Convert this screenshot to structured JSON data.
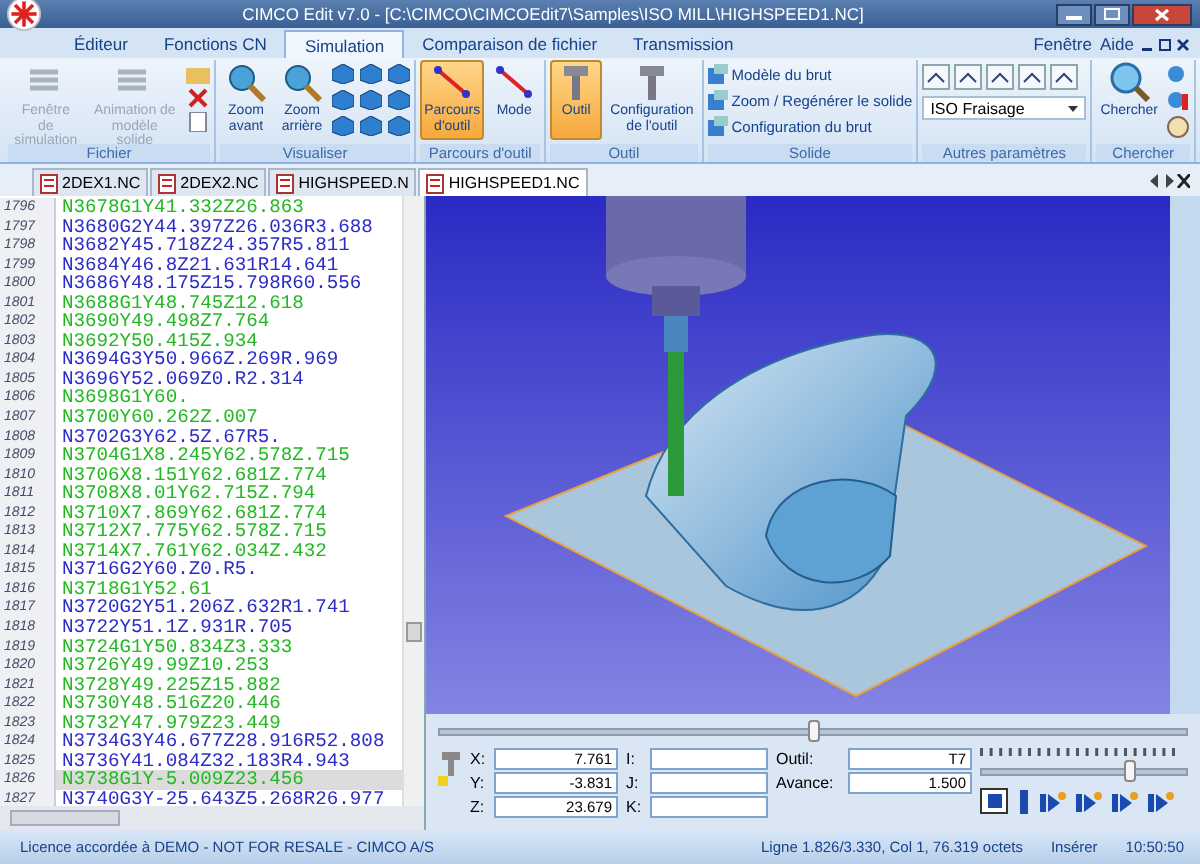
{
  "window": {
    "title": "CIMCO Edit v7.0 - [C:\\CIMCO\\CIMCOEdit7\\Samples\\ISO MILL\\HIGHSPEED1.NC]"
  },
  "menu_tabs": [
    {
      "label": "Éditeur",
      "selected": false
    },
    {
      "label": "Fonctions CN",
      "selected": false
    },
    {
      "label": "Simulation",
      "selected": true
    },
    {
      "label": "Comparaison de fichier",
      "selected": false
    },
    {
      "label": "Transmission",
      "selected": false
    }
  ],
  "menu_right": [
    {
      "label": "Fenêtre"
    },
    {
      "label": "Aide"
    }
  ],
  "ribbon_groups": [
    {
      "kind": "file",
      "label": "Fichier",
      "buttons": [
        {
          "label": "Fenêtre de simulation",
          "disabled": true,
          "selected": false
        },
        {
          "label": "Animation de modèle solide",
          "disabled": true,
          "selected": false
        }
      ]
    },
    {
      "kind": "view",
      "label": "Visualiser",
      "buttons": [
        {
          "label": "Zoom avant",
          "disabled": false,
          "selected": false
        },
        {
          "label": "Zoom arrière",
          "disabled": false,
          "selected": false
        }
      ]
    },
    {
      "kind": "path",
      "label": "Parcours d'outil",
      "buttons": [
        {
          "label": "Parcours d'outil",
          "disabled": false,
          "selected": true
        },
        {
          "label": "Mode",
          "disabled": false,
          "selected": false
        }
      ]
    },
    {
      "kind": "tool",
      "label": "Outil",
      "buttons": [
        {
          "label": "Outil",
          "disabled": false,
          "selected": true
        },
        {
          "label": "Configuration de l'outil",
          "disabled": false,
          "selected": false
        }
      ]
    },
    {
      "kind": "solid",
      "label": "Solide",
      "links": [
        "Modèle du brut",
        "Zoom / Regénérer le solide",
        "Configuration du brut"
      ]
    },
    {
      "kind": "settings",
      "label": "Autres paramètres",
      "select": "ISO Fraisage"
    },
    {
      "kind": "search",
      "label": "Chercher",
      "buttons": [
        {
          "label": "Chercher",
          "disabled": false,
          "selected": false
        }
      ]
    }
  ],
  "doc_tabs": [
    {
      "label": "2DEX1.NC",
      "selected": false
    },
    {
      "label": "2DEX2.NC",
      "selected": false
    },
    {
      "label": "HIGHSPEED.N",
      "selected": false
    },
    {
      "label": "HIGHSPEED1.NC",
      "selected": true
    }
  ],
  "code_lines": [
    {
      "number": "1796",
      "text": "N3678G1Y41.332Z26.863",
      "color": "#22b822",
      "selected": false
    },
    {
      "number": "1797",
      "text": "N3680G2Y44.397Z26.036R3.688",
      "color": "#2b2bc8",
      "selected": false
    },
    {
      "number": "1798",
      "text": "N3682Y45.718Z24.357R5.811",
      "color": "#2b2bc8",
      "selected": false
    },
    {
      "number": "1799",
      "text": "N3684Y46.8Z21.631R14.641",
      "color": "#2b2bc8",
      "selected": false
    },
    {
      "number": "1800",
      "text": "N3686Y48.175Z15.798R60.556",
      "color": "#2b2bc8",
      "selected": false
    },
    {
      "number": "1801",
      "text": "N3688G1Y48.745Z12.618",
      "color": "#22b822",
      "selected": false
    },
    {
      "number": "1802",
      "text": "N3690Y49.498Z7.764",
      "color": "#22b822",
      "selected": false
    },
    {
      "number": "1803",
      "text": "N3692Y50.415Z.934",
      "color": "#22b822",
      "selected": false
    },
    {
      "number": "1804",
      "text": "N3694G3Y50.966Z.269R.969",
      "color": "#2b2bc8",
      "selected": false
    },
    {
      "number": "1805",
      "text": "N3696Y52.069Z0.R2.314",
      "color": "#2b2bc8",
      "selected": false
    },
    {
      "number": "1806",
      "text": "N3698G1Y60.",
      "color": "#22b822",
      "selected": false
    },
    {
      "number": "1807",
      "text": "N3700Y60.262Z.007",
      "color": "#22b822",
      "selected": false
    },
    {
      "number": "1808",
      "text": "N3702G3Y62.5Z.67R5.",
      "color": "#2b2bc8",
      "selected": false
    },
    {
      "number": "1809",
      "text": "N3704G1X8.245Y62.578Z.715",
      "color": "#22b822",
      "selected": false
    },
    {
      "number": "1810",
      "text": "N3706X8.151Y62.681Z.774",
      "color": "#22b822",
      "selected": false
    },
    {
      "number": "1811",
      "text": "N3708X8.01Y62.715Z.794",
      "color": "#22b822",
      "selected": false
    },
    {
      "number": "1812",
      "text": "N3710X7.869Y62.681Z.774",
      "color": "#22b822",
      "selected": false
    },
    {
      "number": "1813",
      "text": "N3712X7.775Y62.578Z.715",
      "color": "#22b822",
      "selected": false
    },
    {
      "number": "1814",
      "text": "N3714X7.761Y62.034Z.432",
      "color": "#22b822",
      "selected": false
    },
    {
      "number": "1815",
      "text": "N3716G2Y60.Z0.R5.",
      "color": "#2b2bc8",
      "selected": false
    },
    {
      "number": "1816",
      "text": "N3718G1Y52.61",
      "color": "#22b822",
      "selected": false
    },
    {
      "number": "1817",
      "text": "N3720G2Y51.206Z.632R1.741",
      "color": "#2b2bc8",
      "selected": false
    },
    {
      "number": "1818",
      "text": "N3722Y51.1Z.931R.705",
      "color": "#2b2bc8",
      "selected": false
    },
    {
      "number": "1819",
      "text": "N3724G1Y50.834Z3.333",
      "color": "#22b822",
      "selected": false
    },
    {
      "number": "1820",
      "text": "N3726Y49.99Z10.253",
      "color": "#22b822",
      "selected": false
    },
    {
      "number": "1821",
      "text": "N3728Y49.225Z15.882",
      "color": "#22b822",
      "selected": false
    },
    {
      "number": "1822",
      "text": "N3730Y48.516Z20.446",
      "color": "#22b822",
      "selected": false
    },
    {
      "number": "1823",
      "text": "N3732Y47.979Z23.449",
      "color": "#22b822",
      "selected": false
    },
    {
      "number": "1824",
      "text": "N3734G3Y46.677Z28.916R52.808",
      "color": "#2b2bc8",
      "selected": false
    },
    {
      "number": "1825",
      "text": "N3736Y41.084Z32.183R4.943",
      "color": "#2b2bc8",
      "selected": false
    },
    {
      "number": "1826",
      "text": "N3738G1Y-5.009Z23.456",
      "color": "#22b822",
      "selected": true
    },
    {
      "number": "1827",
      "text": "N3740G3Y-25.643Z5.268R26.977",
      "color": "#2b2bc8",
      "selected": false
    }
  ],
  "simulation": {
    "position": {
      "level": 0.5
    },
    "speed": {
      "level": 0.73
    },
    "coords": [
      {
        "label": "X:",
        "value": "7.761"
      },
      {
        "label": "Y:",
        "value": "-3.831"
      },
      {
        "label": "Z:",
        "value": "23.679"
      }
    ],
    "arcs": [
      {
        "label": "I:"
      },
      {
        "label": "J:"
      },
      {
        "label": "K:"
      }
    ],
    "info": [
      {
        "label": "Outil:",
        "value": "T7"
      },
      {
        "label": "Avance:",
        "value": "1.500"
      }
    ]
  },
  "status_bar": {
    "license": "Licence accordée à DEMO - NOT FOR RESALE - CIMCO A/S",
    "position": "Ligne 1.826/3.330, Col 1, 76.319 octets",
    "mode": "Insérer",
    "time": "10:50:50"
  }
}
